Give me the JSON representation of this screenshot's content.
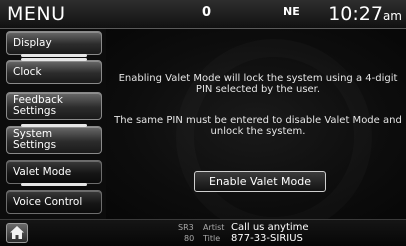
{
  "header": {
    "title": "MENU",
    "status_icon_1": "0",
    "status_icon_2": "NE",
    "clock_time": "10:27",
    "clock_ampm": "am"
  },
  "sidebar": {
    "items": [
      {
        "label": "Display"
      },
      {
        "label": "Clock"
      },
      {
        "label": "Feedback Settings"
      },
      {
        "label": "System Settings"
      },
      {
        "label": "Valet Mode"
      },
      {
        "label": "Voice Control"
      }
    ],
    "selected": "Valet Mode"
  },
  "main": {
    "message_1": "Enabling Valet Mode will lock the system using a 4-digit PIN selected by the user.",
    "message_2": "The same PIN must be entered to disable Valet Mode and unlock the system.",
    "enable_button_label": "Enable Valet Mode"
  },
  "footer": {
    "source": "SR3",
    "channel": "80",
    "artist_label": "Artist",
    "artist_value": "Call us anytime",
    "title_label": "Title",
    "title_value": "877-33-SIRIUS",
    "home_icon": "home-icon"
  },
  "colors": {
    "background": "#0c0c0c",
    "text": "#ffffff",
    "button_border": "#cfcfcf"
  }
}
